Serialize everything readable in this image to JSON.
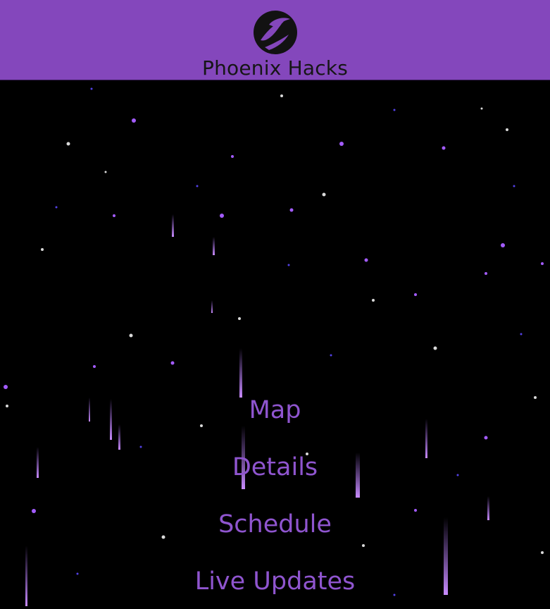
{
  "header": {
    "title": "Phoenix Hacks",
    "logo": "phoenix-logo-icon",
    "color": "#8447bc"
  },
  "menu": {
    "items": [
      {
        "label": "Map"
      },
      {
        "label": "Details"
      },
      {
        "label": "Schedule"
      },
      {
        "label": "Live Updates"
      }
    ],
    "color": "#8f55cf"
  },
  "background": {
    "type": "purple-starfield"
  }
}
